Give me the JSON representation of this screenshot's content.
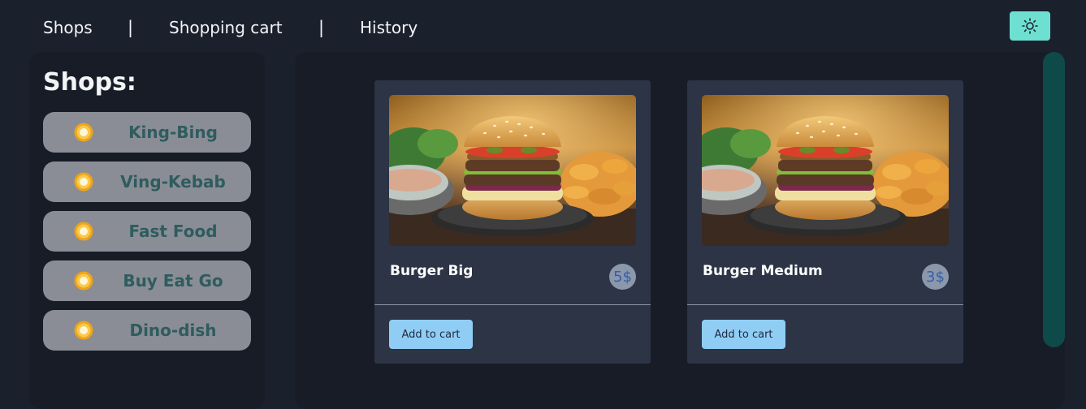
{
  "nav": {
    "links": [
      "Shops",
      "Shopping cart",
      "History"
    ],
    "separator": "|",
    "theme_icon": "sun-icon"
  },
  "sidebar": {
    "title": "Shops:",
    "items": [
      {
        "label": "King-Bing",
        "icon": "radio-dot-icon"
      },
      {
        "label": "Ving-Kebab",
        "icon": "radio-dot-icon"
      },
      {
        "label": "Fast Food",
        "icon": "radio-dot-icon"
      },
      {
        "label": "Buy Eat Go",
        "icon": "radio-dot-icon"
      },
      {
        "label": "Dino-dish",
        "icon": "radio-dot-icon"
      }
    ]
  },
  "products": [
    {
      "name": "Burger Big",
      "price": "5$",
      "button": "Add to cart",
      "image": "burger-photo"
    },
    {
      "name": "Burger Medium",
      "price": "3$",
      "button": "Add to cart",
      "image": "burger-photo"
    }
  ],
  "colors": {
    "background": "#1b202d",
    "panel": "#171c27",
    "card": "#2c3446",
    "accent": "#6ee0d2",
    "shop_item": "#8a8d95",
    "shop_label": "#2e5c5f",
    "button": "#90cdf4",
    "scrollbar": "#0f4a4b"
  }
}
